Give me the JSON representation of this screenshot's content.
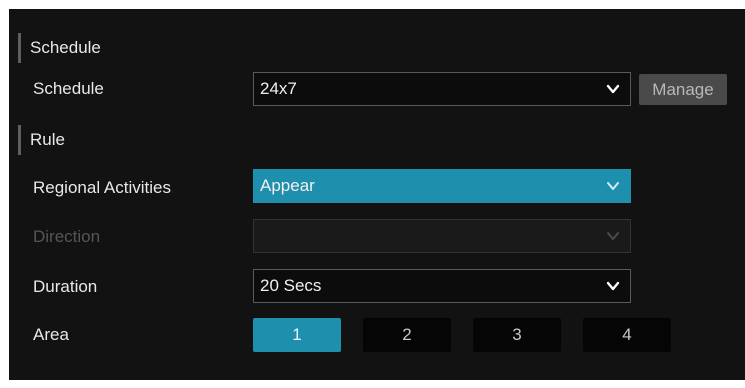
{
  "sections": {
    "schedule_title": "Schedule",
    "rule_title": "Rule"
  },
  "schedule": {
    "label": "Schedule",
    "value": "24x7",
    "manage_label": "Manage"
  },
  "regional_activities": {
    "label": "Regional Activities",
    "value": "Appear"
  },
  "direction": {
    "label": "Direction",
    "value": "",
    "disabled": true
  },
  "duration": {
    "label": "Duration",
    "value": "20 Secs"
  },
  "area": {
    "label": "Area",
    "options": [
      "1",
      "2",
      "3",
      "4"
    ],
    "selected": "1"
  },
  "colors": {
    "accent": "#1f8fae",
    "background": "#121212",
    "text": "#e8e8e8",
    "disabled_text": "#555555"
  },
  "icons": {
    "dropdown": "chevron-down-icon"
  }
}
